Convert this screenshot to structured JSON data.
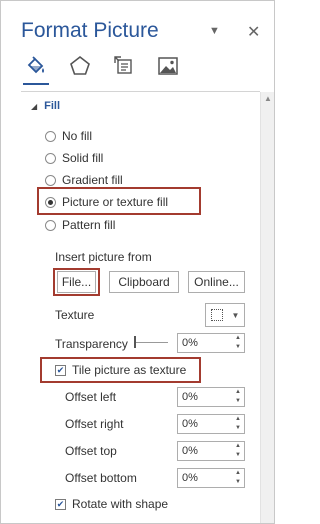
{
  "pane": {
    "title": "Format Picture",
    "dropdown_glyph": "▼",
    "close_glyph": "✕",
    "tabs": [
      {
        "icon": "paint-bucket-icon",
        "name": "Fill & Line"
      },
      {
        "icon": "pentagon-icon",
        "name": "Effects"
      },
      {
        "icon": "size-properties-icon",
        "name": "Size & Properties"
      },
      {
        "icon": "picture-icon",
        "name": "Picture"
      }
    ],
    "accent_color": "#2b579a",
    "highlight_color": "#a33b2f"
  },
  "fill": {
    "section_label": "Fill",
    "options": [
      {
        "label": "No fill",
        "selected": false
      },
      {
        "label": "Solid fill",
        "selected": false
      },
      {
        "label": "Gradient fill",
        "selected": false
      },
      {
        "label": "Picture or texture fill",
        "selected": true
      },
      {
        "label": "Pattern fill",
        "selected": false
      }
    ],
    "insert_picture_from": "Insert picture from",
    "file_button": "File...",
    "clipboard_button": "Clipboard",
    "online_button": "Online...",
    "texture_label": "Texture",
    "transparency_label": "Transparency",
    "transparency_value": "0%",
    "tile_label": "Tile picture as texture",
    "tile_checked": true,
    "offset_left_label": "Offset left",
    "offset_left_value": "0%",
    "offset_right_label": "Offset right",
    "offset_right_value": "0%",
    "offset_top_label": "Offset top",
    "offset_top_value": "0%",
    "offset_bottom_label": "Offset bottom",
    "offset_bottom_value": "0%",
    "rotate_label": "Rotate with shape",
    "rotate_checked": true
  }
}
